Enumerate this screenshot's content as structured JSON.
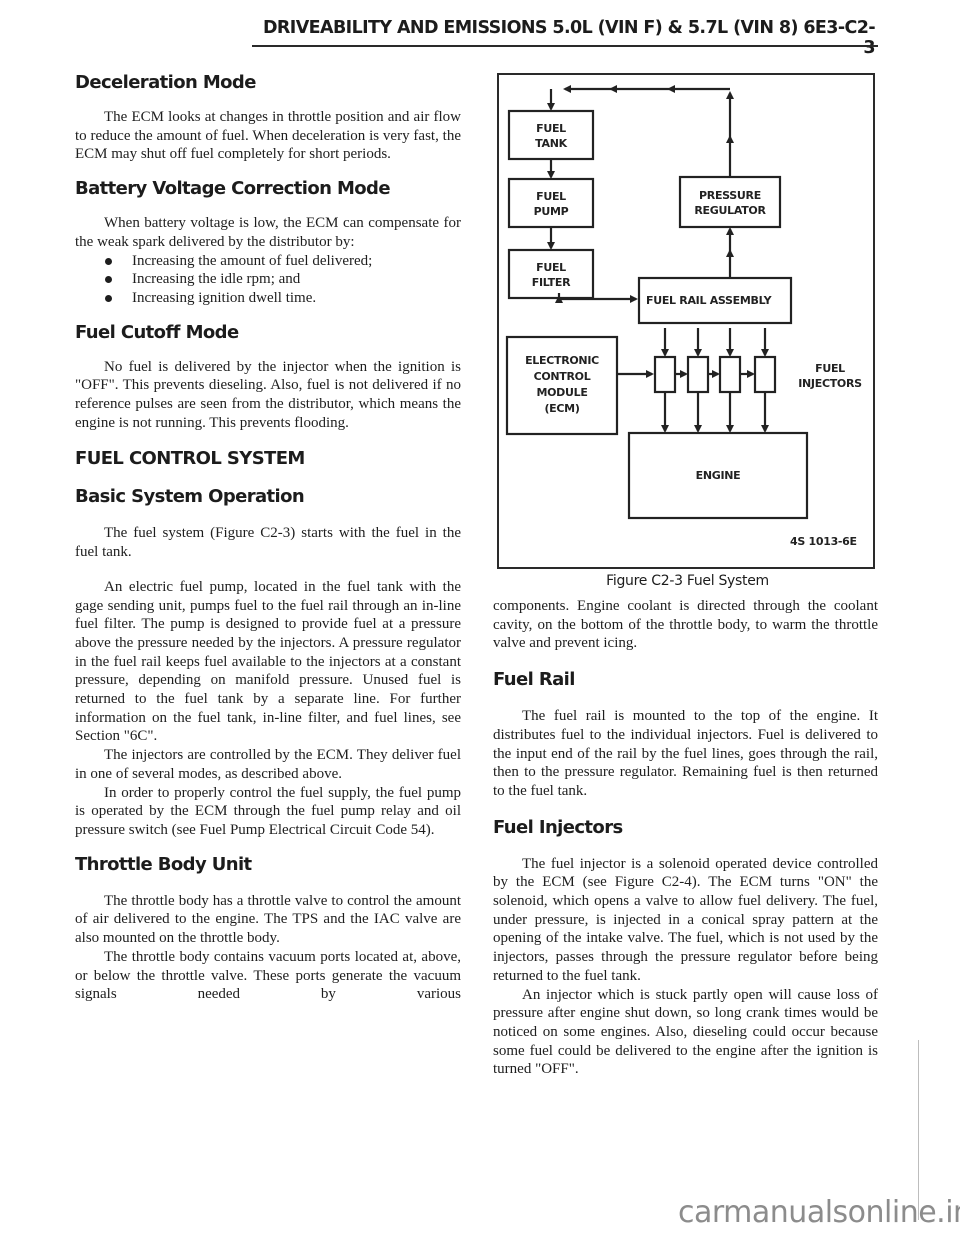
{
  "header": {
    "title": "DRIVEABILITY AND EMISSIONS  5.0L  (VIN F)  &  5.7L (VIN 8)  6E3-C2-3"
  },
  "left_column": {
    "deceleration": {
      "heading": "Deceleration Mode",
      "body": "The ECM looks at changes in throttle position and air flow to reduce the amount of fuel.  When deceleration is very fast, the ECM may shut off fuel completely for short periods."
    },
    "battery": {
      "heading": "Battery Voltage Correction Mode",
      "body": "When battery voltage is low, the ECM can compensate for the weak spark delivered by the distributor by:",
      "bullets": [
        "Increasing the amount of fuel delivered;",
        "Increasing the idle rpm; and",
        "Increasing ignition dwell time."
      ]
    },
    "cutoff": {
      "heading": "Fuel Cutoff Mode",
      "body": "No fuel is delivered by the injector when the ignition is \"OFF\".  This prevents dieseling.  Also, fuel is not delivered if no reference pulses are seen from the distributor, which means the engine is not running.  This prevents flooding."
    },
    "fuel_control": {
      "heading": "FUEL CONTROL SYSTEM"
    },
    "basic": {
      "heading": "Basic System Operation",
      "p1": "The fuel system (Figure C2-3) starts with the fuel in the fuel tank.",
      "p2": "An electric fuel pump, located in the fuel tank with the gage sending unit, pumps fuel to the fuel rail through an in-line fuel filter.  The pump is designed to provide fuel at a pressure above the pressure needed by the injectors.  A pressure regulator in the fuel rail keeps fuel available to the injectors at a constant pressure, depending on manifold pressure.  Unused fuel is returned to the fuel tank by a separate line.  For further information on the fuel tank, in-line filter, and fuel lines, see Section \"6C\".",
      "p3": "The injectors are controlled by the ECM.  They deliver fuel in one of several modes, as described above.",
      "p4": "In order to properly control the fuel supply, the fuel pump is operated by the ECM through the fuel pump relay and oil pressure switch (see Fuel Pump Electrical Circuit Code 54)."
    },
    "throttle": {
      "heading": "Throttle Body Unit",
      "p1": "The throttle body has a throttle valve to control the amount of air delivered to the engine.  The TPS and the IAC valve are also mounted on the throttle body.",
      "p2": "The throttle body contains vacuum ports located at, above, or below the throttle valve.  These ports generate the vacuum signals needed by various"
    }
  },
  "figure": {
    "caption": "Figure C2-3 Fuel  System",
    "code": "4S 1013-6E",
    "blocks": {
      "fuel_tank": [
        "FUEL",
        "TANK"
      ],
      "fuel_pump": [
        "FUEL",
        "PUMP"
      ],
      "fuel_filter": [
        "FUEL",
        "FILTER"
      ],
      "pressure_regulator": [
        "PRESSURE",
        "REGULATOR"
      ],
      "fuel_rail": "FUEL RAIL ASSEMBLY",
      "ecm": [
        "ELECTRONIC",
        "CONTROL",
        "MODULE",
        "(ECM)"
      ],
      "injectors_label": [
        "FUEL",
        "INJECTORS"
      ],
      "engine": "ENGINE"
    },
    "injector_count": 4
  },
  "right_column": {
    "continuation": "components.  Engine coolant is directed through the coolant cavity, on the bottom of the throttle body, to warm the throttle valve and prevent icing.",
    "fuel_rail": {
      "heading": "Fuel Rail",
      "body": "The fuel rail is mounted to the top of the engine. It distributes fuel to the individual injectors. Fuel is delivered to the input end of the rail by the fuel lines, goes through the rail, then to the pressure regulator. Remaining fuel is then returned to the fuel tank."
    },
    "injectors": {
      "heading": "Fuel Injectors",
      "p1": "The fuel injector is a solenoid operated device controlled by the ECM (see Figure C2-4). The ECM turns \"ON\" the solenoid, which opens a valve to allow fuel delivery.  The fuel, under pressure, is injected in a conical spray pattern at the opening of the intake valve.  The fuel, which is not used by the injectors, passes through the pressure regulator before being returned to the fuel tank.",
      "p2": "An injector which is stuck partly open will cause loss of pressure after engine shut down, so long crank times would be noticed on some engines.  Also, dieseling could occur because some fuel could be delivered to the engine after the ignition is turned \"OFF\"."
    }
  },
  "watermark": "carmanualsonline.info"
}
